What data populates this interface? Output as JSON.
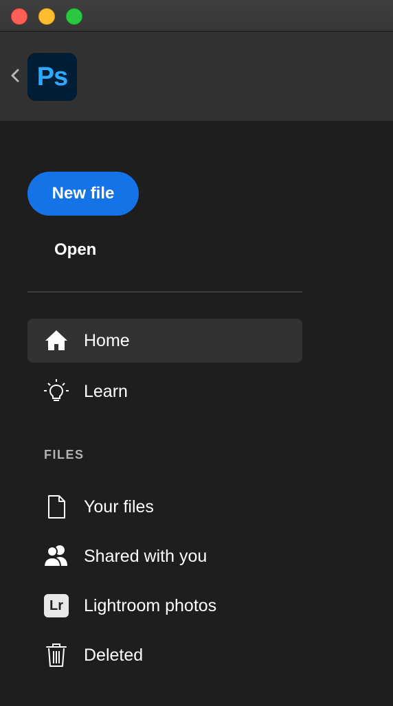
{
  "app": {
    "logo_text": "Ps"
  },
  "actions": {
    "new_file_label": "New file",
    "open_label": "Open"
  },
  "nav": {
    "items": [
      {
        "id": "home",
        "label": "Home",
        "icon": "home-icon",
        "active": true
      },
      {
        "id": "learn",
        "label": "Learn",
        "icon": "lightbulb-icon",
        "active": false
      }
    ]
  },
  "files": {
    "section_label": "FILES",
    "items": [
      {
        "id": "your-files",
        "label": "Your files",
        "icon": "file-icon"
      },
      {
        "id": "shared",
        "label": "Shared with you",
        "icon": "users-icon"
      },
      {
        "id": "lightroom",
        "label": "Lightroom photos",
        "icon": "lightroom-icon",
        "badge_text": "Lr"
      },
      {
        "id": "deleted",
        "label": "Deleted",
        "icon": "trash-icon"
      }
    ]
  },
  "colors": {
    "accent": "#1473e6",
    "background": "#1e1e1e",
    "header": "#323232",
    "logo_bg": "#001e36",
    "logo_text": "#31a8ff"
  }
}
